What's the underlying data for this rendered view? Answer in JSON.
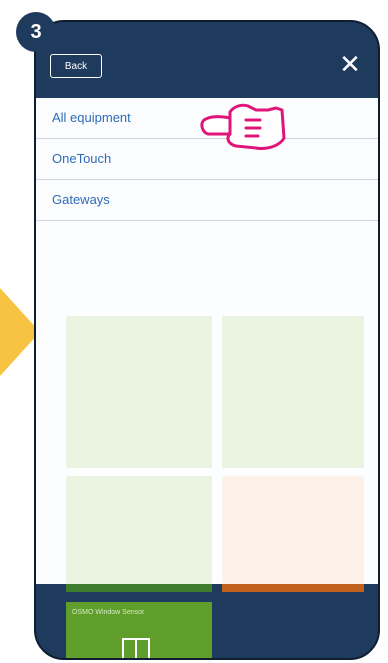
{
  "step": {
    "number": "3"
  },
  "header": {
    "back_label": "Back",
    "close_icon": "close-icon"
  },
  "menu": {
    "items": [
      {
        "label": "All equipment"
      },
      {
        "label": "OneTouch"
      },
      {
        "label": "Gateways"
      }
    ]
  },
  "background": {
    "device_card_label": "OSMO Window Sensor"
  },
  "colors": {
    "brand": "#1e3a5c",
    "link": "#2f6bb6",
    "arrow": "#f6c342",
    "pointer": "#e0157a",
    "green_card": "#5f9e2b",
    "orange_card": "#c1611e"
  }
}
